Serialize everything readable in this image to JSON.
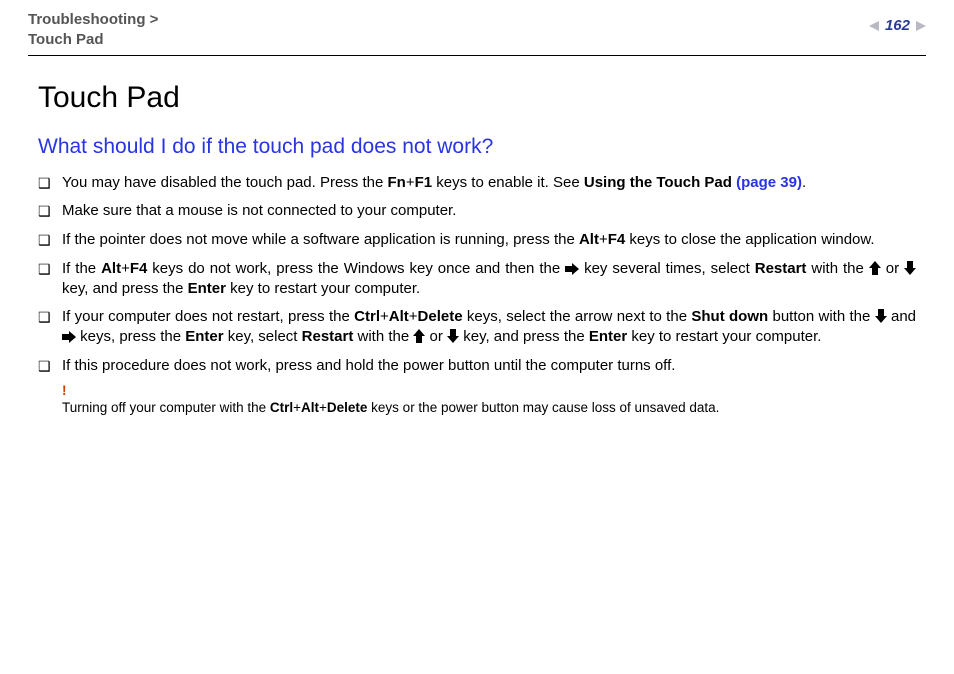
{
  "header": {
    "breadcrumb_top": "Troubleshooting",
    "breadcrumb_sep": ">",
    "breadcrumb_bottom": "Touch Pad",
    "page_number": "162"
  },
  "title": "Touch Pad",
  "question": "What should I do if the touch pad does not work?",
  "bullets": {
    "b0": {
      "pre": "You may have disabled the touch pad. Press the ",
      "k1": "Fn",
      "plus1": "+",
      "k2": "F1",
      "mid": " keys to enable it. See ",
      "see": "Using the Touch Pad ",
      "link": "(page 39)",
      "end": "."
    },
    "b1": "Make sure that a mouse is not connected to your computer.",
    "b2": {
      "pre": "If the pointer does not move while a software application is running, press the ",
      "k1": "Alt",
      "plus1": "+",
      "k2": "F4",
      "post": " keys to close the application window."
    },
    "b3": {
      "pre": "If the ",
      "k1": "Alt",
      "plus1": "+",
      "k2": "F4",
      "mid1": " keys do not work, press the Windows key once and then the ",
      "mid2": " key several times, select ",
      "k3": "Restart",
      "mid3": " with the ",
      "mid4": " or ",
      "mid5": " key, and press the ",
      "k4": "Enter",
      "post": " key to restart your computer."
    },
    "b4": {
      "pre": "If your computer does not restart, press the ",
      "k1": "Ctrl",
      "plus1": "+",
      "k2": "Alt",
      "plus2": "+",
      "k3": "Delete",
      "mid1": " keys, select the arrow next to the ",
      "k4": "Shut down",
      "mid2": " button with the ",
      "mid3": " and ",
      "mid4": " keys, press the ",
      "k5": "Enter",
      "mid5": " key, select ",
      "k6": "Restart",
      "mid6": " with the ",
      "mid7": " or ",
      "mid8": " key, and press the ",
      "k7": "Enter",
      "post": " key to restart your computer."
    },
    "b5": "If this procedure does not work, press and hold the power button until the computer turns off."
  },
  "note": {
    "bang": "!",
    "pre": "Turning off your computer with the ",
    "k1": "Ctrl",
    "plus1": "+",
    "k2": "Alt",
    "plus2": "+",
    "k3": "Delete",
    "post": " keys or the power button may cause loss of unsaved data."
  }
}
